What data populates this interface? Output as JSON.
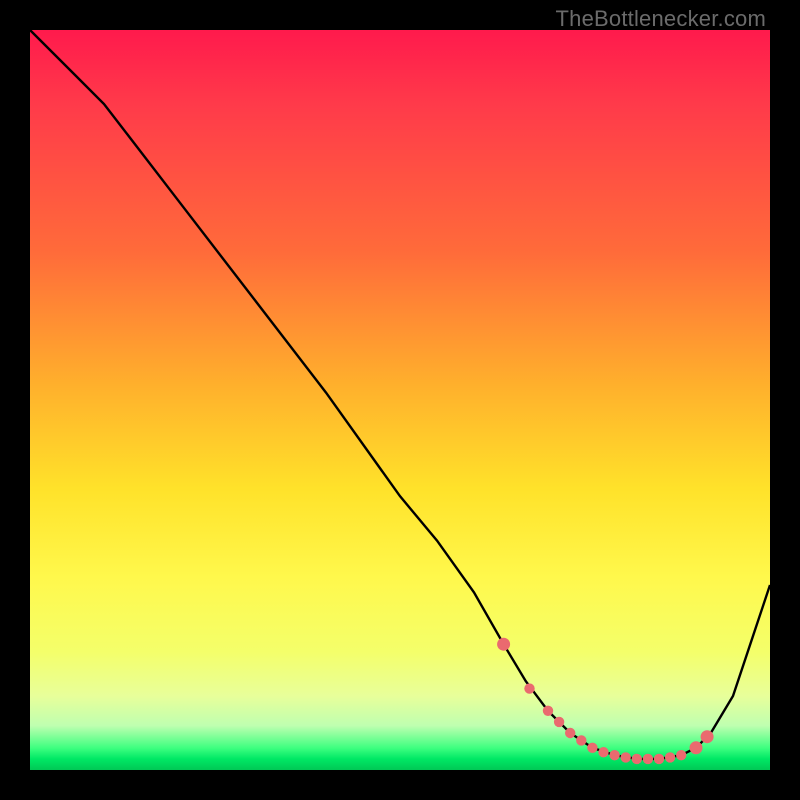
{
  "watermark": "TheBottlenecker.com",
  "colors": {
    "line": "#000000",
    "marker": "#ea6a6f",
    "background_top": "#ff1a4c",
    "background_mid": "#ffe22a",
    "background_bottom": "#00c855"
  },
  "chart_data": {
    "type": "line",
    "title": "",
    "xlabel": "",
    "ylabel": "",
    "xlim": [
      0,
      100
    ],
    "ylim": [
      0,
      100
    ],
    "series": [
      {
        "name": "curve",
        "x": [
          0,
          6,
          10,
          20,
          30,
          40,
          50,
          55,
          60,
          64,
          67,
          70,
          73,
          76,
          79,
          82,
          85,
          88,
          90,
          92,
          95,
          100
        ],
        "y": [
          100,
          94,
          90,
          77,
          64,
          51,
          37,
          31,
          24,
          17,
          12,
          8,
          5,
          3,
          2,
          1.5,
          1.5,
          2,
          3,
          5,
          10,
          25
        ]
      }
    ],
    "markers": {
      "name": "valley-points",
      "x": [
        64,
        67.5,
        70,
        71.5,
        73,
        74.5,
        76,
        77.5,
        79,
        80.5,
        82,
        83.5,
        85,
        86.5,
        88,
        90,
        91.5
      ],
      "y": [
        17,
        11,
        8,
        6.5,
        5,
        4,
        3,
        2.4,
        2,
        1.7,
        1.5,
        1.5,
        1.5,
        1.7,
        2,
        3,
        4.5
      ]
    }
  }
}
